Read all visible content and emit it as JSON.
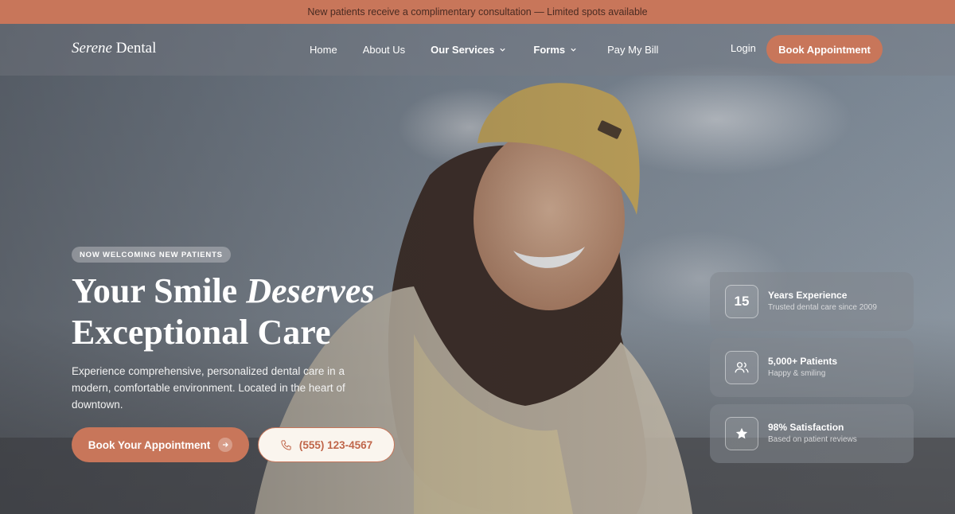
{
  "announcement": "New patients receive a complimentary consultation — Limited spots available",
  "brand": {
    "italic": "Serene",
    "regular": "Dental"
  },
  "nav": {
    "items": [
      {
        "label": "Home",
        "dropdown": false
      },
      {
        "label": "About Us",
        "dropdown": false
      },
      {
        "label": "Our Services",
        "dropdown": true
      },
      {
        "label": "Forms",
        "dropdown": true
      },
      {
        "label": "Pay My Bill",
        "dropdown": false
      }
    ],
    "login": "Login",
    "cta": "Book Appointment"
  },
  "hero": {
    "badge": "NOW WELCOMING NEW PATIENTS",
    "headline_a": "Your Smile ",
    "headline_em": "Deserves",
    "headline_b": "Exceptional Care",
    "subtext": "Experience comprehensive, personalized dental care in a modern, comfortable environment. Located in the heart of downtown.",
    "primary_button": "Book Your Appointment",
    "phone_button": "(555) 123-4567"
  },
  "stats": [
    {
      "icon": "number-15",
      "badge": "15",
      "title": "Years Experience",
      "subtitle": "Trusted dental care since 2009"
    },
    {
      "icon": "users-icon",
      "title": "5,000+ Patients",
      "subtitle": "Happy & smiling"
    },
    {
      "icon": "star-icon",
      "title": "98% Satisfaction",
      "subtitle": "Based on patient reviews"
    }
  ],
  "colors": {
    "accent": "#c8765a",
    "announce_text": "#4a2b22",
    "phone_bg": "#faf5ee"
  }
}
